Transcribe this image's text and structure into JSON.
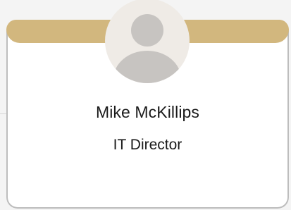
{
  "profile": {
    "name": "Mike McKillips",
    "title": "IT Director",
    "avatar_icon": "user-silhouette-icon"
  },
  "colors": {
    "band": "#d2b77e",
    "avatar_bg": "#efebe6",
    "avatar_figure": "#c7c4c1",
    "card_border": "#bdbdbd"
  }
}
